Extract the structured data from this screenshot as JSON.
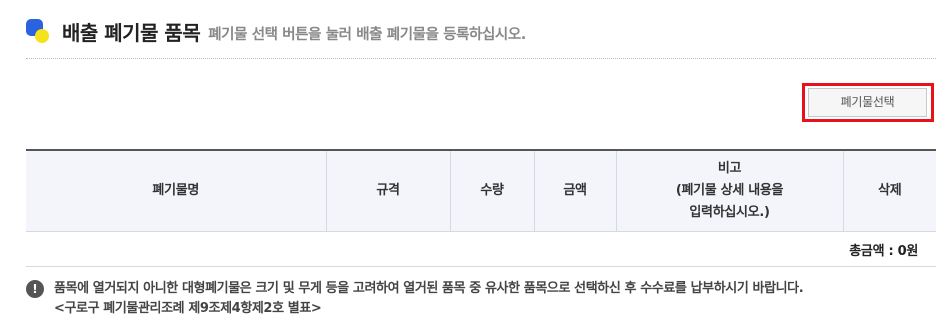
{
  "header": {
    "title": "배출 폐기물 품목",
    "subtitle": "폐기물 선택 버튼을 눌러 배출 폐기물을 등록하십시오.",
    "icon": "blue-yellow-dots-icon"
  },
  "toolbar": {
    "select_label": "폐기물선택"
  },
  "table": {
    "columns": {
      "name": "폐기물명",
      "spec": "규격",
      "qty": "수량",
      "amount": "금액",
      "note_line1": "비고",
      "note_line2": "(폐기물 상세 내용을",
      "note_line3": "입력하십시오.)",
      "delete": "삭제"
    },
    "total": "총금액 : 0원"
  },
  "notice": {
    "icon": "exclamation-icon",
    "line1": "품목에 열거되지 아니한 대형폐기물은 크기 및 무게 등을 고려하여 열거된 품목 중 유사한 품목으로 선택하신 후 수수료를 납부하시기 바랍니다.",
    "line2": "<구로구 폐기물관리조례 제9조제4항제2호 별표>"
  },
  "colors": {
    "accent_blue": "#2a63e0",
    "accent_yellow": "#f4e31b",
    "highlight_red": "#e8121a",
    "header_bg": "#f3f5fb"
  }
}
